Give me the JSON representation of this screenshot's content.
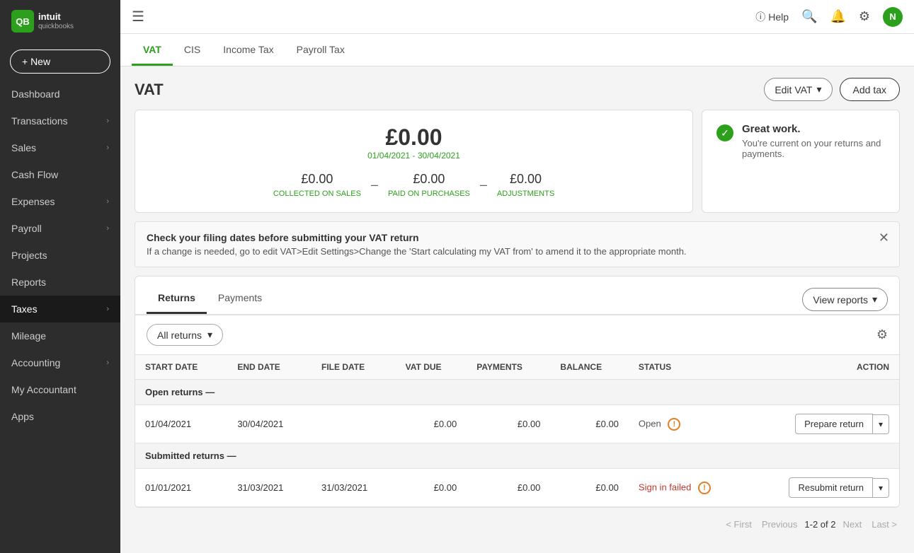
{
  "sidebar": {
    "logo_text": "intuit quickbooks",
    "logo_initial": "QB",
    "new_button": "+ New",
    "items": [
      {
        "label": "Dashboard",
        "active": false,
        "has_arrow": false
      },
      {
        "label": "Transactions",
        "active": false,
        "has_arrow": true
      },
      {
        "label": "Sales",
        "active": false,
        "has_arrow": true
      },
      {
        "label": "Cash Flow",
        "active": false,
        "has_arrow": false
      },
      {
        "label": "Expenses",
        "active": false,
        "has_arrow": true
      },
      {
        "label": "Payroll",
        "active": false,
        "has_arrow": true
      },
      {
        "label": "Projects",
        "active": false,
        "has_arrow": false
      },
      {
        "label": "Reports",
        "active": false,
        "has_arrow": false
      },
      {
        "label": "Taxes",
        "active": true,
        "has_arrow": true
      },
      {
        "label": "Mileage",
        "active": false,
        "has_arrow": false
      },
      {
        "label": "Accounting",
        "active": false,
        "has_arrow": true
      },
      {
        "label": "My Accountant",
        "active": false,
        "has_arrow": false
      },
      {
        "label": "Apps",
        "active": false,
        "has_arrow": false
      }
    ]
  },
  "topbar": {
    "help_label": "Help",
    "user_initial": "N"
  },
  "tabs": [
    {
      "label": "VAT",
      "active": true
    },
    {
      "label": "CIS",
      "active": false
    },
    {
      "label": "Income Tax",
      "active": false
    },
    {
      "label": "Payroll Tax",
      "active": false
    }
  ],
  "page_title": "VAT",
  "edit_vat_button": "Edit VAT",
  "add_tax_button": "Add tax",
  "summary": {
    "total": "£0.00",
    "period": "01/04/2021 - 30/04/2021",
    "collected_amount": "£0.00",
    "collected_label": "COLLECTED ON SALES",
    "paid_amount": "£0.00",
    "paid_label": "PAID ON PURCHASES",
    "adjustments_amount": "£0.00",
    "adjustments_label": "ADJUSTMENTS"
  },
  "status_card": {
    "title": "Great work.",
    "text": "You're current on your returns and payments."
  },
  "alert": {
    "title": "Check your filing dates before submitting your VAT return",
    "text": "If a change is needed, go to edit VAT>Edit Settings>Change the 'Start calculating my VAT from' to amend it to the appropriate month."
  },
  "returns_section": {
    "tab_returns": "Returns",
    "tab_payments": "Payments",
    "view_reports_button": "View reports",
    "filter_label": "All returns",
    "table_headers": [
      "START DATE",
      "END DATE",
      "FILE DATE",
      "VAT DUE",
      "PAYMENTS",
      "BALANCE",
      "STATUS",
      "ACTION"
    ],
    "groups": [
      {
        "group_label": "Open returns —",
        "rows": [
          {
            "start_date": "01/04/2021",
            "end_date": "30/04/2021",
            "file_date": "",
            "vat_due": "£0.00",
            "payments": "£0.00",
            "balance": "£0.00",
            "status": "Open",
            "status_type": "open",
            "action": "Prepare return"
          }
        ]
      },
      {
        "group_label": "Submitted returns —",
        "rows": [
          {
            "start_date": "01/01/2021",
            "end_date": "31/03/2021",
            "file_date": "31/03/2021",
            "vat_due": "£0.00",
            "payments": "£0.00",
            "balance": "£0.00",
            "status": "Sign in failed",
            "status_type": "failed",
            "action": "Resubmit return"
          }
        ]
      }
    ]
  },
  "pagination": {
    "first": "< First",
    "previous": "Previous",
    "info": "1-2 of 2",
    "next": "Next",
    "last": "Last >"
  }
}
